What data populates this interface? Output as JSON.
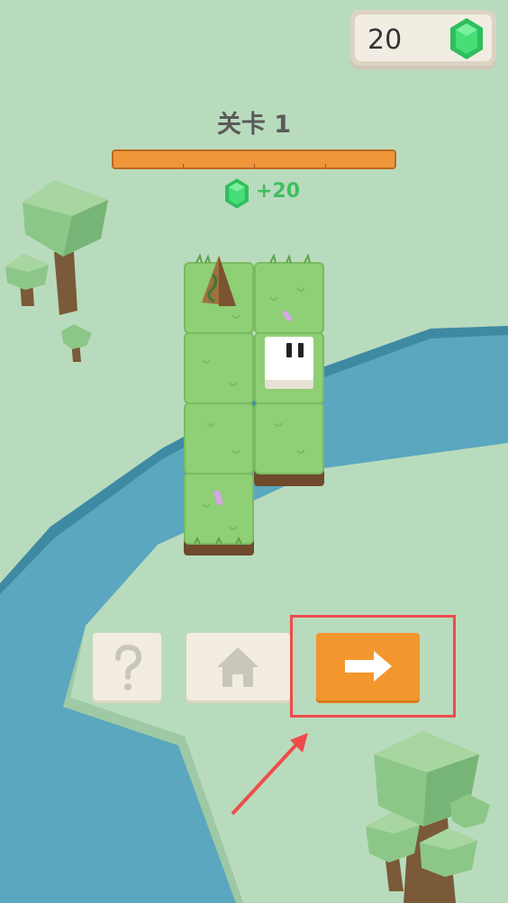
{
  "hud": {
    "gem_count": "20",
    "gem_icon": "emerald-gem-icon"
  },
  "level": {
    "title": "关卡 1",
    "progress_percent": 100,
    "reward_text": "+20",
    "reward_icon": "emerald-gem-icon"
  },
  "buttons": {
    "help_icon": "question-mark-icon",
    "home_icon": "house-icon",
    "next_icon": "right-arrow-icon"
  },
  "colors": {
    "background": "#b9dbbd",
    "river": "#5aa7bf",
    "grass": "#8fcf76",
    "accent_orange": "#f4962e",
    "highlight_red": "#ee4c4c",
    "gem_green": "#3fd06a"
  }
}
